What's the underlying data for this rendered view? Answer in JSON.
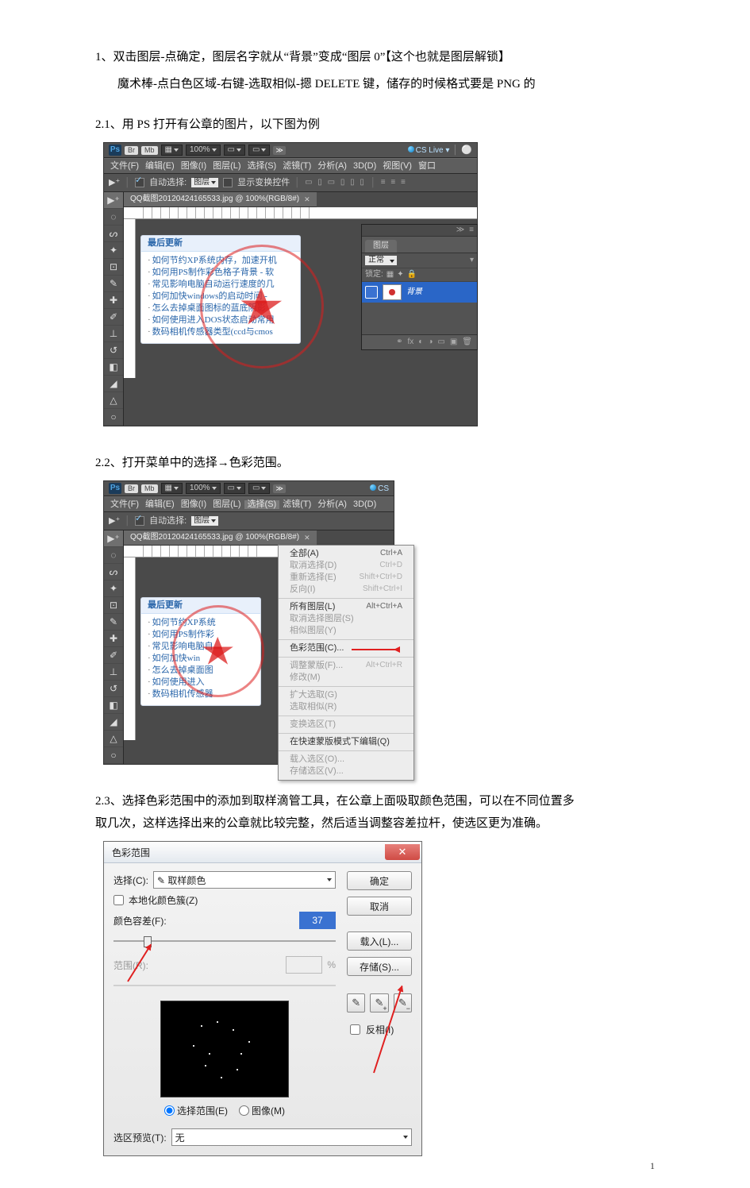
{
  "text": {
    "step1_line1": "1、双击图层-点确定，图层名字就从“背景”变成“图层 0”【这个也就是图层解锁】",
    "step1_line2": "魔术棒-点白色区域-右键-选取相似-摁 DELETE 键，储存的时候格式要是 PNG 的",
    "step2_1": "2.1、用 PS 打开有公章的图片，以下图为例",
    "step2_2": "2.2、打开菜单中的选择→色彩范围。",
    "step2_3_line1": "2.3、选择色彩范围中的添加到取样滴管工具，在公章上面吸取颜色范围，可以在不同位置多",
    "step2_3_line2": "取几次，这样选择出来的公章就比较完整，然后适当调整容差拉杆，使选区更为准确。"
  },
  "ps": {
    "logo": "Ps",
    "br": "Br",
    "mb": "Mb",
    "zoom": "100%",
    "cslive": "CS Live",
    "menu": [
      "文件(F)",
      "编辑(E)",
      "图像(I)",
      "图层(L)",
      "选择(S)",
      "滤镜(T)",
      "分析(A)",
      "3D(D)",
      "视图(V)",
      "窗口"
    ],
    "options": {
      "autoSelect": "自动选择:",
      "layerDD": "图层",
      "showTransform": "显示变换控件"
    },
    "tabTitle": "QQ截图20120424165533.jpg @ 100%(RGB/8#)",
    "sample": {
      "header": "最后更新",
      "rows": [
        "如何节约XP系统内存，加速开机",
        "如何用PS制作彩色格子背景 - 软",
        "常见影响电脑自动运行速度的几",
        "如何加快windows的启动时间 -",
        "怎么去掉桌面图标的蓝底阴影",
        "如何使用进入DOS状态启动常用",
        "数码相机传感器类型(ccd与cmos"
      ]
    },
    "layersPanel": {
      "tab": "图层",
      "blend": "正常",
      "lockLabel": "锁定:",
      "layerName": "背景"
    },
    "selectMenu": {
      "g1": [
        {
          "label": "全部(A)",
          "sc": "Ctrl+A"
        },
        {
          "label": "取消选择(D)",
          "sc": "Ctrl+D"
        },
        {
          "label": "重新选择(E)",
          "sc": "Shift+Ctrl+D"
        },
        {
          "label": "反向(I)",
          "sc": "Shift+Ctrl+I"
        }
      ],
      "g2": [
        {
          "label": "所有图层(L)",
          "sc": "Alt+Ctrl+A"
        },
        {
          "label": "取消选择图层(S)",
          "sc": "",
          "dis": true
        },
        {
          "label": "相似图层(Y)",
          "sc": "",
          "dis": true
        }
      ],
      "g3": [
        {
          "label": "色彩范围(C)...",
          "sc": ""
        }
      ],
      "g4": [
        {
          "label": "调整蒙版(F)...",
          "sc": "Alt+Ctrl+R",
          "dis": true
        },
        {
          "label": "修改(M)",
          "sc": "",
          "dis": true
        }
      ],
      "g5": [
        {
          "label": "扩大选取(G)",
          "sc": "",
          "dis": true
        },
        {
          "label": "选取相似(R)",
          "sc": "",
          "dis": true
        }
      ],
      "g6": [
        {
          "label": "变换选区(T)",
          "sc": "",
          "dis": true
        }
      ],
      "g7": [
        {
          "label": "在快速蒙版模式下编辑(Q)",
          "sc": ""
        }
      ],
      "g8": [
        {
          "label": "载入选区(O)...",
          "sc": "",
          "dis": true
        },
        {
          "label": "存储选区(V)...",
          "sc": "",
          "dis": true
        }
      ]
    }
  },
  "dlg": {
    "title": "色彩范围",
    "selectLabel": "选择(C):",
    "eyedropper": "✎",
    "selectValue": "取样颜色",
    "localize": "本地化颜色簇(Z)",
    "fuzziness": "颜色容差(F):",
    "fuzzinessValue": "37",
    "rangeLabel": "范围(R):",
    "rangeUnit": "%",
    "radioSelection": "选择范围(E)",
    "radioImage": "图像(M)",
    "selectionPreviewLabel": "选区预览(T):",
    "selectionPreviewValue": "无",
    "ok": "确定",
    "cancel": "取消",
    "load": "载入(L)...",
    "save": "存储(S)...",
    "invert": "反相(I)"
  },
  "pageNumber": "1"
}
